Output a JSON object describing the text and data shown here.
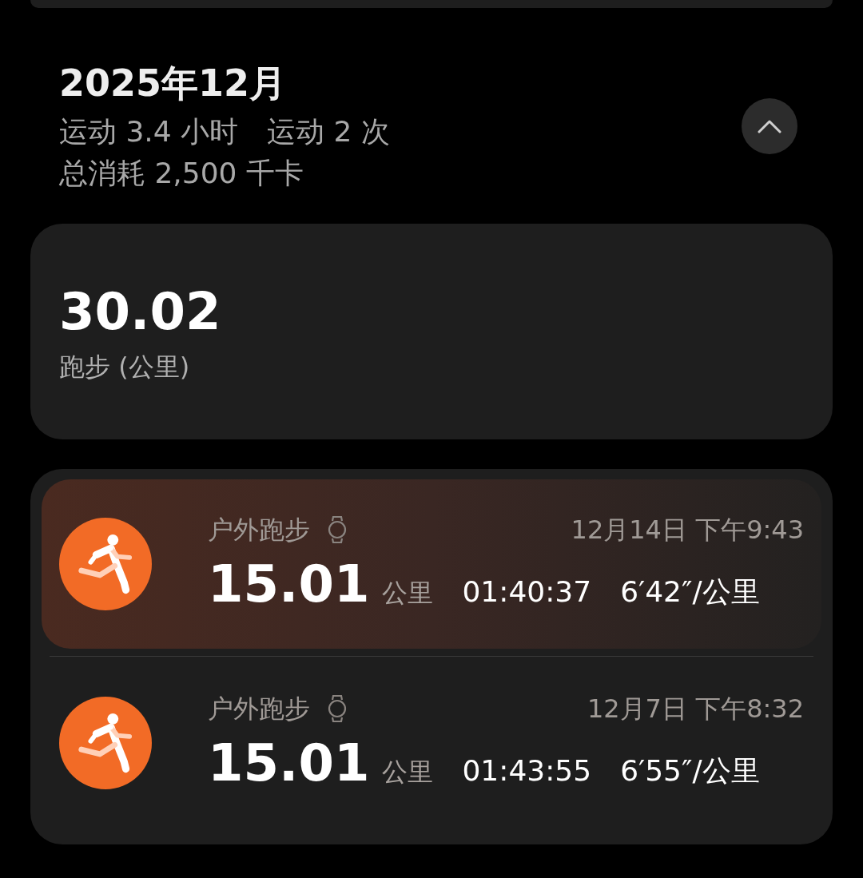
{
  "month": {
    "title": "2025年12月",
    "stats": [
      "运动 3.4 小时",
      "运动 2 次"
    ],
    "calories": "总消耗 2,500 千卡",
    "expanded": true
  },
  "summary": {
    "value": "30.02",
    "label": "跑步 (公里)"
  },
  "records": [
    {
      "type": "户外跑步",
      "date": "12月14日 下午9:43",
      "distance": "15.01",
      "unit": "公里",
      "duration": "01:40:37",
      "pace": "6′42″/公里",
      "selected": true
    },
    {
      "type": "户外跑步",
      "date": "12月7日 下午8:32",
      "distance": "15.01",
      "unit": "公里",
      "duration": "01:43:55",
      "pace": "6′55″/公里",
      "selected": false
    }
  ]
}
